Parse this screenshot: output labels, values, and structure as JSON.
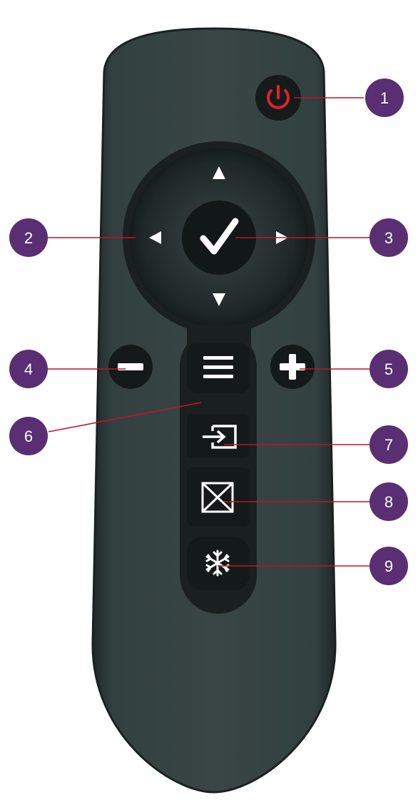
{
  "colors": {
    "background": "#ffffff",
    "remote_body": "#2f3a3a",
    "remote_edge": "#1e2626",
    "button": "#151a1a",
    "button_glyph": "#ffffff",
    "power_glyph": "#e3222c",
    "callout_badge": "#5a2e72",
    "callout_line": "#c0142a"
  },
  "buttons": [
    {
      "id": 1,
      "icon": "power-icon"
    },
    {
      "id": 2,
      "icon": "arrow-left-icon"
    },
    {
      "id": 3,
      "icon": "arrow-right-icon"
    },
    {
      "id": 4,
      "icon": "minus-icon"
    },
    {
      "id": 5,
      "icon": "plus-icon"
    },
    {
      "id": 6,
      "icon": "menu-icon"
    },
    {
      "id": 7,
      "icon": "input-source-icon"
    },
    {
      "id": 8,
      "icon": "blank-screen-icon"
    },
    {
      "id": 9,
      "icon": "freeze-snowflake-icon"
    }
  ],
  "center_icon": "checkmark-icon",
  "callouts": [
    {
      "label": "1"
    },
    {
      "label": "2"
    },
    {
      "label": "3"
    },
    {
      "label": "4"
    },
    {
      "label": "5"
    },
    {
      "label": "6"
    },
    {
      "label": "7"
    },
    {
      "label": "8"
    },
    {
      "label": "9"
    }
  ]
}
